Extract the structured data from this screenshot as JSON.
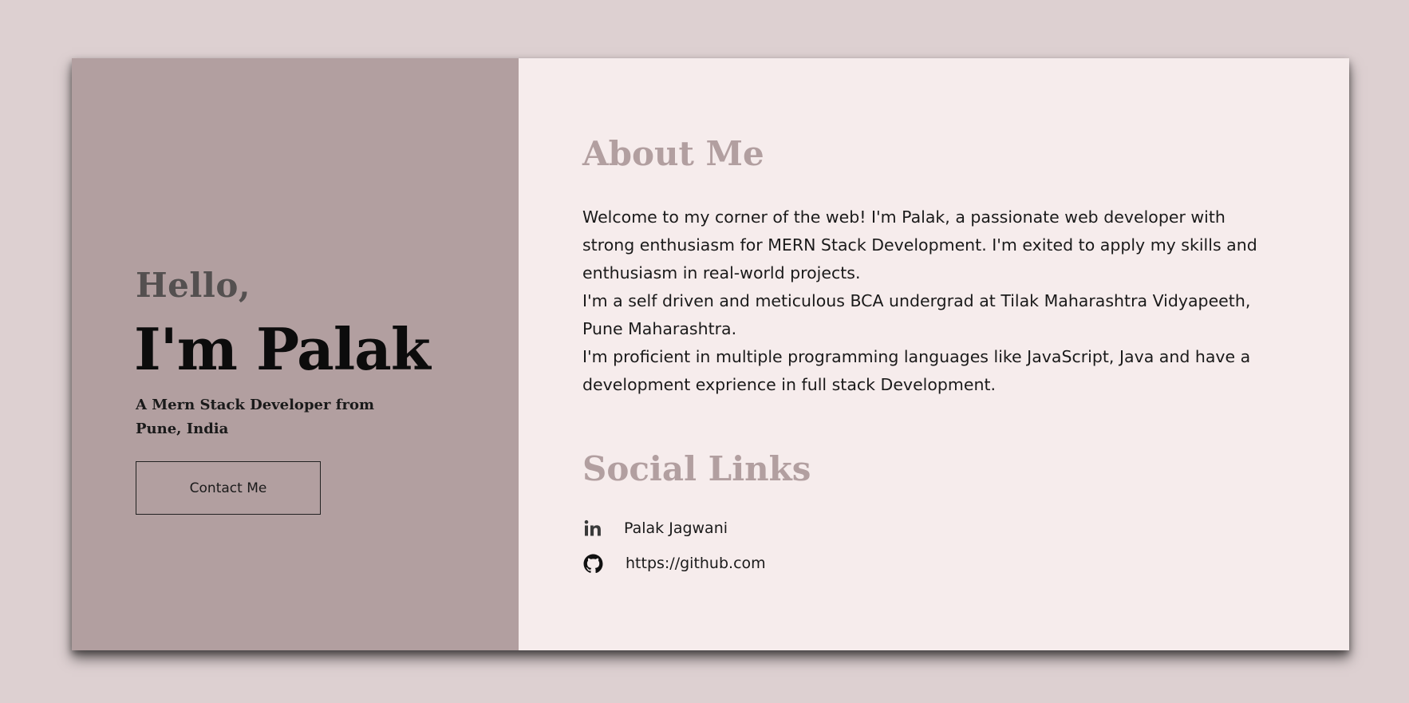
{
  "hero": {
    "greeting": "Hello,",
    "name": "I'm Palak",
    "tagline": "A Mern Stack Developer from Pune, India",
    "contact_label": "Contact Me"
  },
  "about": {
    "title": "About Me",
    "paragraphs": [
      "Welcome to my corner of the web! I'm Palak, a passionate web developer with strong enthusiasm for MERN Stack Development. I'm exited to apply my skills and enthusiasm in real-world projects.",
      "I'm a self driven and meticulous BCA undergrad at Tilak Maharashtra Vidyapeeth, Pune Maharashtra.",
      "I'm proficient in multiple programming languages like JavaScript, Java and have a development exprience in full stack Development."
    ]
  },
  "social": {
    "title": "Social Links",
    "links": [
      {
        "icon": "linkedin-icon",
        "label": "Palak Jagwani"
      },
      {
        "icon": "github-icon",
        "label": "https://github.com"
      }
    ]
  },
  "colors": {
    "page_background": "#ddd0d1",
    "left_panel": "#b29fa0",
    "right_panel": "#f6ecec",
    "heading_accent": "#b29fa0",
    "greeting_text": "#545050"
  }
}
